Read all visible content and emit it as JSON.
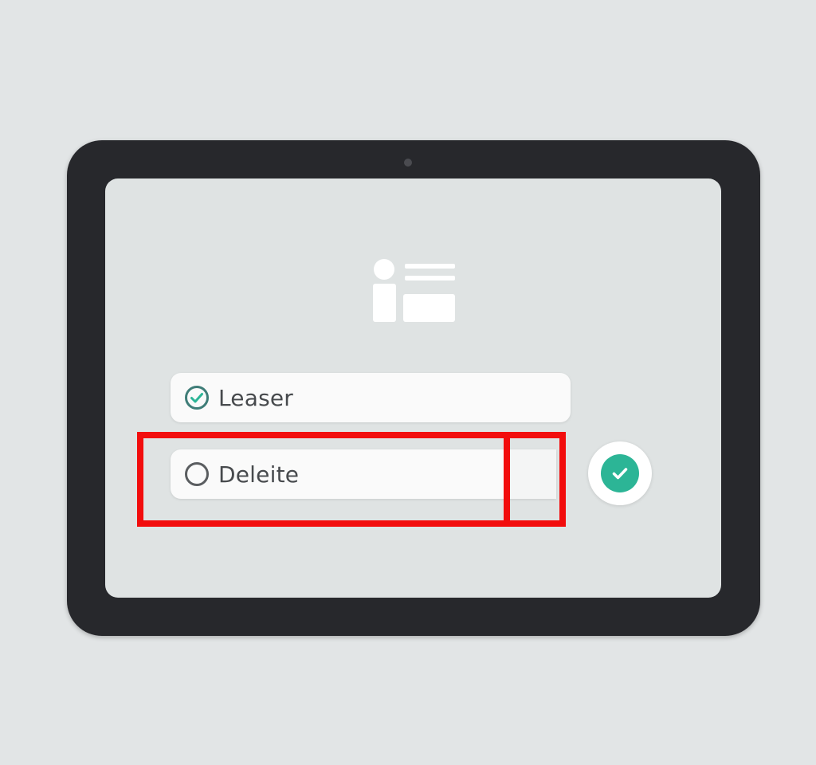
{
  "options": [
    {
      "label": "Leaser",
      "state": "checked",
      "icon": "check-circle-icon"
    },
    {
      "label": "Deleite",
      "state": "unchecked",
      "icon": "empty-circle-icon"
    }
  ],
  "app_icon": "id-card-icon",
  "confirm_icon": "checkmark-icon",
  "colors": {
    "page_bg": "#e2e5e6",
    "device_frame": "#27282c",
    "screen_bg": "#dfe3e3",
    "accent": "#2cb596",
    "highlight": "#f20d0d",
    "icon_white": "#ffffff"
  }
}
